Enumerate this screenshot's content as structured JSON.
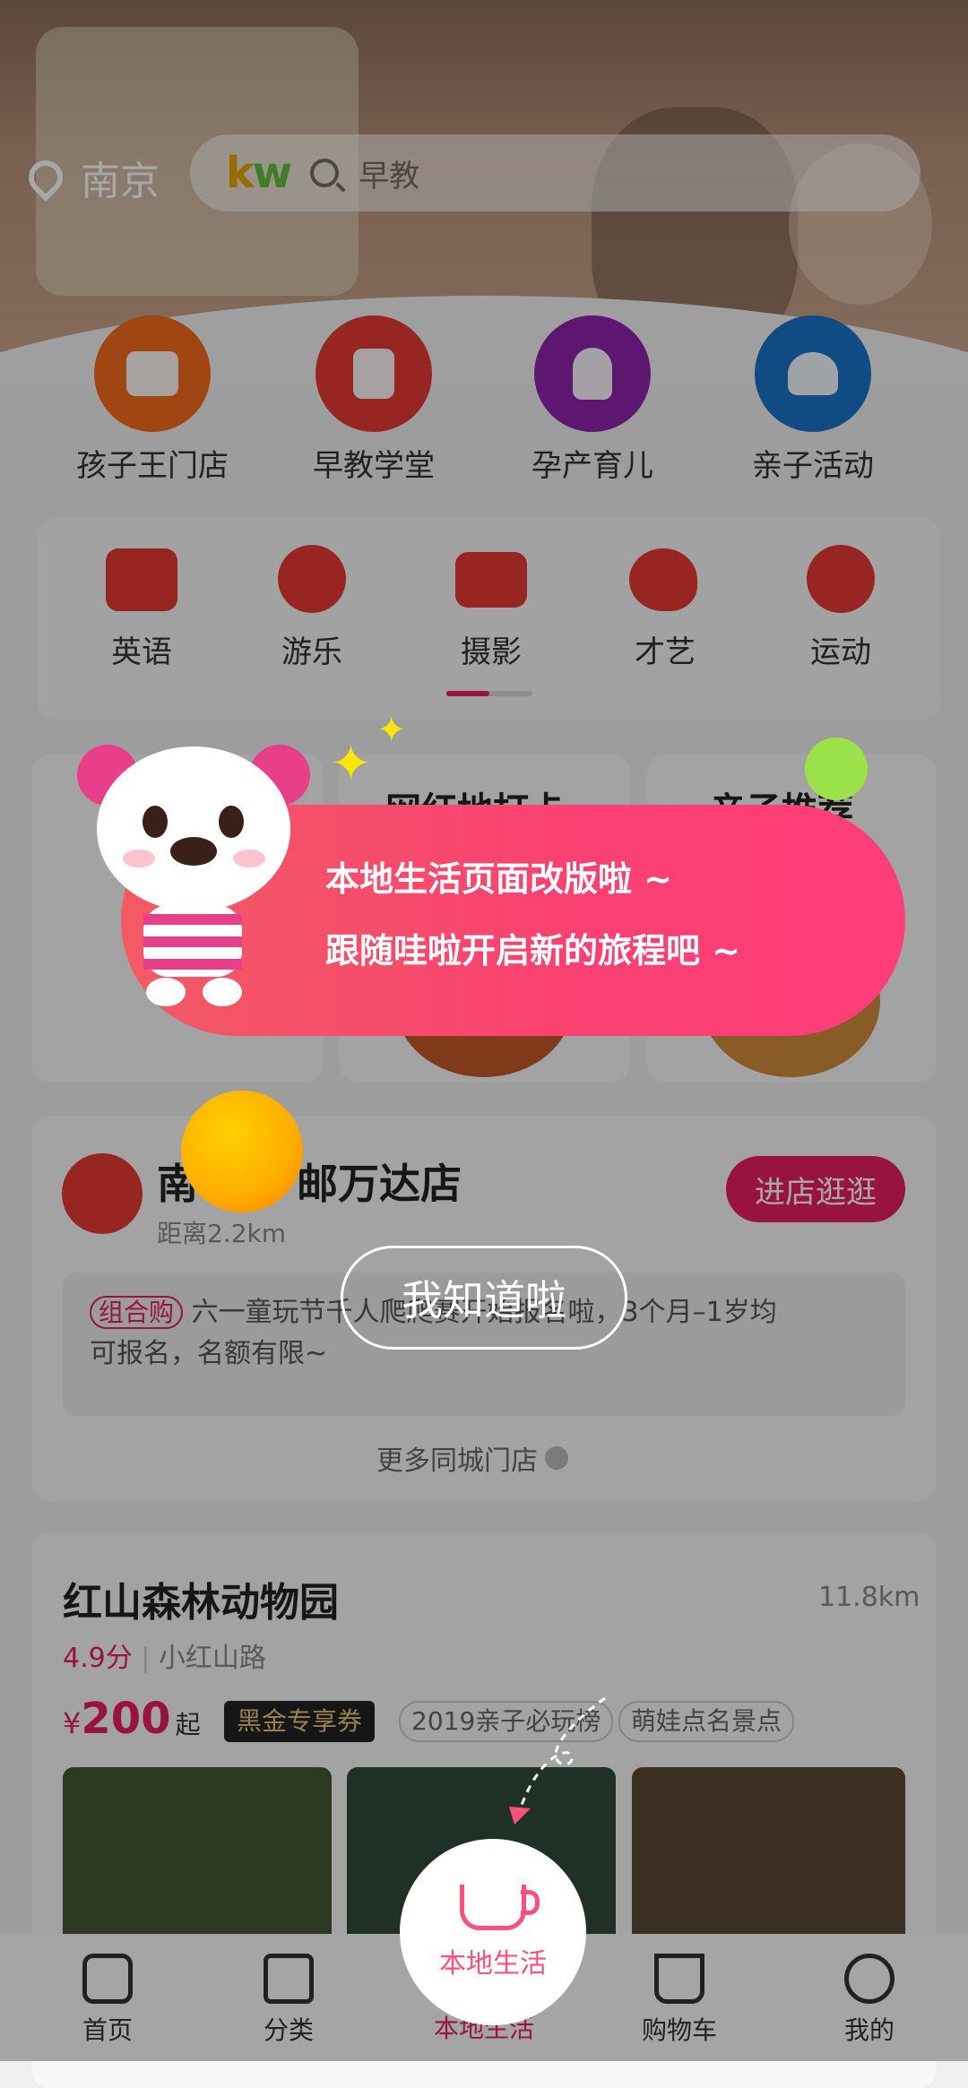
{
  "location": {
    "city": "南京"
  },
  "search": {
    "logo_k": "k",
    "logo_w": "w",
    "placeholder": "早教"
  },
  "main_categories": [
    {
      "label": "孩子王门店",
      "icon": "store-icon",
      "color": "#f26b1d"
    },
    {
      "label": "早教学堂",
      "icon": "book-icon",
      "color": "#e53935"
    },
    {
      "label": "孕产育儿",
      "icon": "rabbit-icon",
      "color": "#8e24aa"
    },
    {
      "label": "亲子活动",
      "icon": "heart-icon",
      "color": "#1a73c9"
    }
  ],
  "sub_categories": [
    {
      "label": "英语",
      "icon": "abc-blocks-icon"
    },
    {
      "label": "游乐",
      "icon": "ferris-wheel-icon"
    },
    {
      "label": "摄影",
      "icon": "camera-icon"
    },
    {
      "label": "才艺",
      "icon": "palette-icon"
    },
    {
      "label": "运动",
      "icon": "ball-icon"
    }
  ],
  "promo_cards": [
    {
      "title": "网红地打卡"
    },
    {
      "title": "亲子推荐"
    }
  ],
  "store": {
    "name_prefix": "南",
    "name_suffix": "邮万达店",
    "distance": "距离2.2km",
    "enter_button": "进店逛逛",
    "tag": "组合购",
    "desc_line1": "六一童玩节千人爬爬赛开始报名啦，3个月–1岁均",
    "desc_line2": "可报名，名额有限~",
    "more": "更多同城门店"
  },
  "zoo": {
    "name": "红山森林动物园",
    "distance": "11.8km",
    "rating": "4.9分",
    "address": "小红山路",
    "price_symbol": "¥",
    "price": "200",
    "price_suffix": "起",
    "tags": [
      "黑金专享券",
      "2019亲子必玩榜",
      "萌娃点名景点"
    ]
  },
  "tabbar": [
    {
      "label": "首页",
      "icon": "home-icon"
    },
    {
      "label": "分类",
      "icon": "category-icon"
    },
    {
      "label": "本地生活",
      "icon": "coffee-cup-icon"
    },
    {
      "label": "购物车",
      "icon": "cart-icon"
    },
    {
      "label": "我的",
      "icon": "bear-face-icon"
    }
  ],
  "guide": {
    "line1": "本地生活页面改版啦 ~",
    "line2": "跟随哇啦开启新的旅程吧 ~",
    "ok_button": "我知道啦",
    "local_label": "本地生活"
  },
  "colors": {
    "accent": "#e91e63",
    "bubble": "#fa4072",
    "local": "#ff4f7b"
  }
}
